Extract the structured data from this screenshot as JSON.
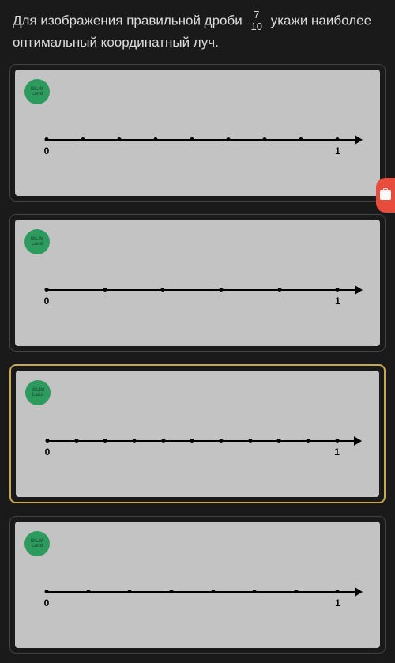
{
  "question": {
    "text_before": "Для изображения правильной дроби",
    "fraction_num": "7",
    "fraction_den": "10",
    "text_after": "укажи наиболее оптимальный координатный луч."
  },
  "logo": {
    "line1": "BILIM",
    "line2": "Land"
  },
  "axis": {
    "start_label": "0",
    "end_label": "1"
  },
  "options": [
    {
      "divisions": 8,
      "selected": false
    },
    {
      "divisions": 5,
      "selected": false
    },
    {
      "divisions": 10,
      "selected": true
    },
    {
      "divisions": 7,
      "selected": false
    }
  ]
}
